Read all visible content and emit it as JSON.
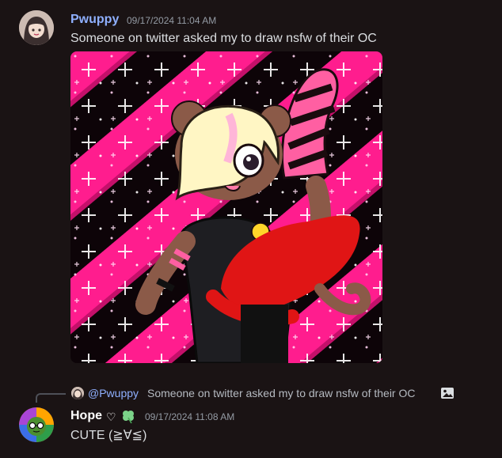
{
  "messages": [
    {
      "username": "Pwuppy",
      "username_color": "#8fb0ff",
      "timestamp": "09/17/2024 11:04 AM",
      "content": "Someone on twitter asked my to draw nsfw of their OC",
      "attachment_icon": "image-attachment"
    },
    {
      "username": "Hope",
      "username_color": "#ffffff",
      "badges": [
        "heart-icon",
        "clover-icon"
      ],
      "heart_glyph": "♡",
      "timestamp": "09/17/2024 11:08 AM",
      "content": "CUTE (≧∀≦)",
      "reply": {
        "username": "@Pwuppy",
        "content": "Someone on twitter asked my to draw nsfw of their OC",
        "icon": "image-icon"
      }
    }
  ],
  "colors": {
    "background": "#1a1314",
    "muted_text": "#949ba4",
    "body_text": "#dbdee1",
    "mention": "#8fb0ff",
    "attachment_pink": "#ff1493",
    "censor_red": "#e01515"
  }
}
